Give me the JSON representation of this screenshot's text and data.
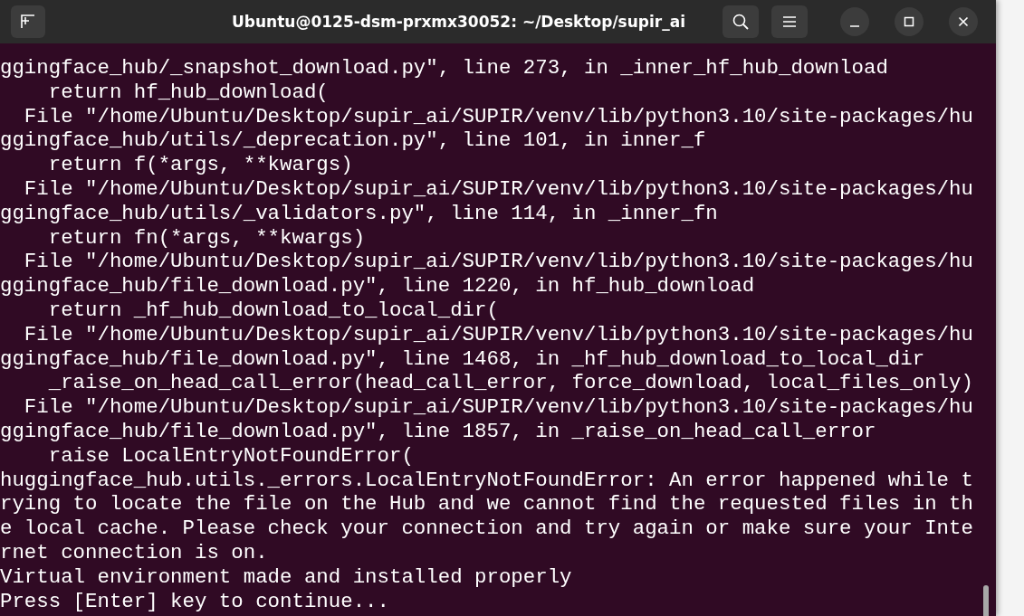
{
  "window": {
    "title": "Ubuntu@0125-dsm-prxmx30052: ~/Desktop/supir_ai"
  },
  "terminal": {
    "lines": [
      "ggingface_hub/_snapshot_download.py\", line 273, in _inner_hf_hub_download",
      "    return hf_hub_download(",
      "  File \"/home/Ubuntu/Desktop/supir_ai/SUPIR/venv/lib/python3.10/site-packages/hu",
      "ggingface_hub/utils/_deprecation.py\", line 101, in inner_f",
      "    return f(*args, **kwargs)",
      "  File \"/home/Ubuntu/Desktop/supir_ai/SUPIR/venv/lib/python3.10/site-packages/hu",
      "ggingface_hub/utils/_validators.py\", line 114, in _inner_fn",
      "    return fn(*args, **kwargs)",
      "  File \"/home/Ubuntu/Desktop/supir_ai/SUPIR/venv/lib/python3.10/site-packages/hu",
      "ggingface_hub/file_download.py\", line 1220, in hf_hub_download",
      "    return _hf_hub_download_to_local_dir(",
      "  File \"/home/Ubuntu/Desktop/supir_ai/SUPIR/venv/lib/python3.10/site-packages/hu",
      "ggingface_hub/file_download.py\", line 1468, in _hf_hub_download_to_local_dir",
      "    _raise_on_head_call_error(head_call_error, force_download, local_files_only)",
      "  File \"/home/Ubuntu/Desktop/supir_ai/SUPIR/venv/lib/python3.10/site-packages/hu",
      "ggingface_hub/file_download.py\", line 1857, in _raise_on_head_call_error",
      "    raise LocalEntryNotFoundError(",
      "huggingface_hub.utils._errors.LocalEntryNotFoundError: An error happened while t",
      "rying to locate the file on the Hub and we cannot find the requested files in th",
      "e local cache. Please check your connection and try again or make sure your Inte",
      "rnet connection is on.",
      "Virtual environment made and installed properly",
      "Press [Enter] key to continue..."
    ]
  }
}
